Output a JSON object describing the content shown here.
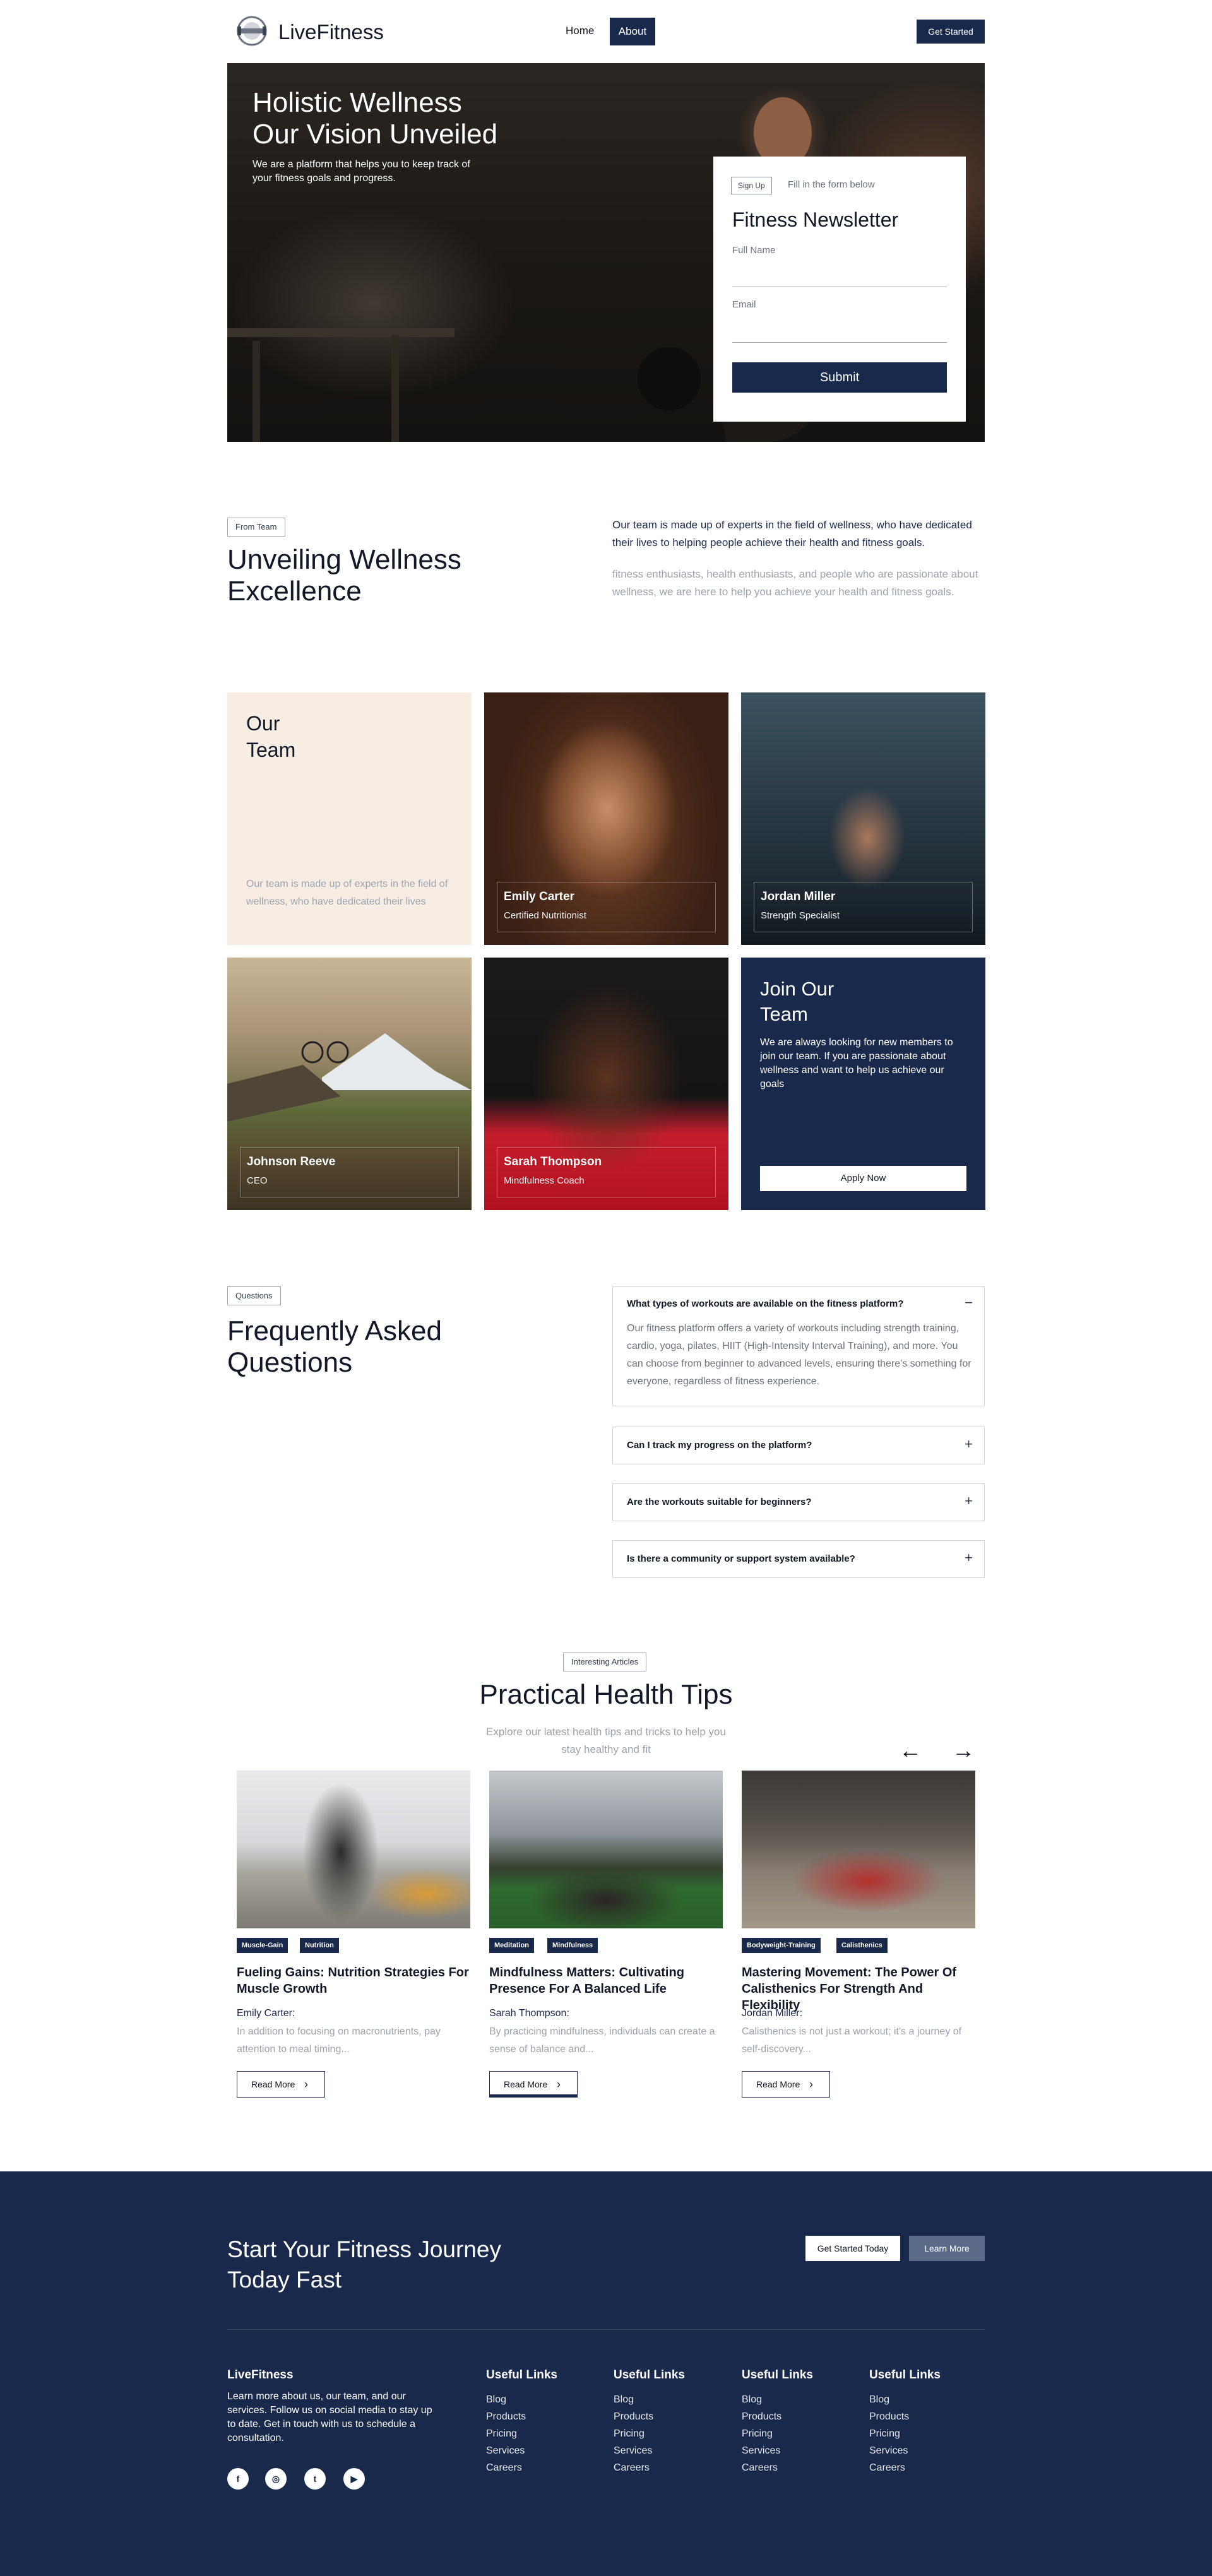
{
  "nav": {
    "brand": "LiveFitness",
    "home": "Home",
    "about": "About",
    "cta": "Get Started"
  },
  "hero": {
    "title_line1": "Holistic Wellness",
    "title_line2": "Our Vision Unveiled",
    "subtitle": "We are a platform that helps you to keep track of your fitness goals and progress.",
    "form": {
      "tag": "Sign Up",
      "hint": "Fill in the form below",
      "title": "Fitness Newsletter",
      "name_label": "Full Name",
      "email_label": "Email",
      "submit": "Submit"
    }
  },
  "team_intro": {
    "tag": "From Team",
    "heading_line1": "Unveiling Wellness",
    "heading_line2": "Excellence",
    "p1": "Our team is made up of experts in the field of wellness, who have dedicated their lives to helping people achieve their health and fitness goals.",
    "p2": "fitness enthusiasts, health enthusiasts, and people who are passionate about wellness, we are here to help you achieve your health and fitness goals."
  },
  "team": {
    "title_line1": "Our",
    "title_line2": "Team",
    "text": "Our team is made up of experts in the field of wellness, who have dedicated their lives",
    "members": [
      {
        "name": "Emily Carter",
        "role": "Certified Nutritionist"
      },
      {
        "name": "Jordan Miller",
        "role": "Strength Specialist"
      },
      {
        "name": "Johnson Reeve",
        "role": "CEO"
      },
      {
        "name": "Sarah Thompson",
        "role": "Mindfulness Coach"
      }
    ],
    "join": {
      "title_line1": "Join Our",
      "title_line2": "Team",
      "text": "We are always looking for new members to join our team. If you are passionate about wellness and want to help us achieve our goals",
      "button": "Apply Now"
    }
  },
  "faq": {
    "tag": "Questions",
    "heading_line1": "Frequently Asked",
    "heading_line2": "Questions",
    "items": [
      {
        "q": "What types of workouts are available on the fitness platform?",
        "a": "Our fitness platform offers a variety of workouts including strength training, cardio, yoga, pilates, HIIT (High-Intensity Interval Training), and more. You can choose from beginner to advanced levels, ensuring there's something for everyone, regardless of fitness experience.",
        "toggle": "−"
      },
      {
        "q": "Can I track my progress on the platform?",
        "toggle": "+"
      },
      {
        "q": "Are the workouts suitable for beginners?",
        "toggle": "+"
      },
      {
        "q": "Is there a community or support system available?",
        "toggle": "+"
      }
    ]
  },
  "articles": {
    "tag": "Interesting Articles",
    "heading": "Practical Health Tips",
    "subtitle": "Explore our latest health tips and tricks to help you stay healthy and fit",
    "prev_arrow": "←",
    "next_arrow": "→",
    "cards": [
      {
        "tags": [
          "Muscle-Gain",
          "Nutrition"
        ],
        "title": "Fueling Gains: Nutrition Strategies For Muscle Growth",
        "author": "Emily Carter:",
        "excerpt": "In addition to focusing on macronutrients, pay attention to meal timing...",
        "button": "Read More"
      },
      {
        "tags": [
          "Meditation",
          "Mindfulness"
        ],
        "title": "Mindfulness Matters: Cultivating Presence For A Balanced Life",
        "author": "Sarah Thompson:",
        "excerpt": "By practicing mindfulness, individuals can create a sense of balance and...",
        "button": "Read More"
      },
      {
        "tags": [
          "Bodyweight-Training",
          "Calisthenics"
        ],
        "title": "Mastering Movement: The Power Of Calisthenics For Strength And Flexibility",
        "author": "Jordan Miller:",
        "excerpt": "Calisthenics is not just a workout; it's a journey of self-discovery...",
        "button": "Read More"
      }
    ]
  },
  "footer": {
    "cta_line1": "Start Your Fitness Journey",
    "cta_line2": "Today Fast",
    "cta_primary": "Get Started Today",
    "cta_secondary": "Learn More",
    "brand": "LiveFitness",
    "brand_text": "Learn more about us, our team, and our services. Follow us on social media to stay up to date. Get in touch with us to schedule a consultation.",
    "columns": [
      {
        "title": "Useful Links",
        "links": [
          "Blog",
          "Products",
          "Pricing",
          "Services",
          "Careers"
        ]
      },
      {
        "title": "Useful Links",
        "links": [
          "Blog",
          "Products",
          "Pricing",
          "Services",
          "Careers"
        ]
      },
      {
        "title": "Useful Links",
        "links": [
          "Blog",
          "Products",
          "Pricing",
          "Services",
          "Careers"
        ]
      },
      {
        "title": "Useful Links",
        "links": [
          "Blog",
          "Products",
          "Pricing",
          "Services",
          "Careers"
        ]
      }
    ],
    "social": [
      "facebook-icon",
      "instagram-icon",
      "twitter-icon",
      "youtube-icon"
    ]
  },
  "colors": {
    "navy": "#18294b",
    "cream": "#f7ede2",
    "muted": "#9ca3af"
  }
}
